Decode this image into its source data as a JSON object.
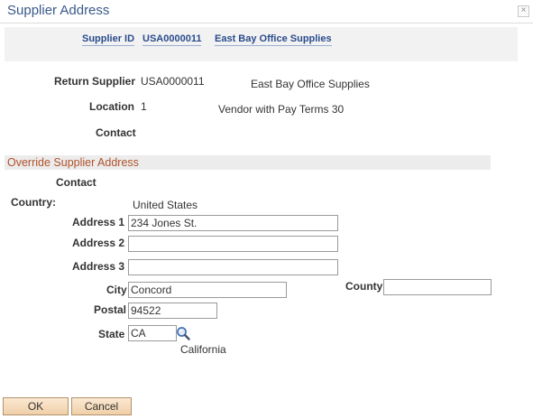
{
  "window": {
    "title": "Supplier Address",
    "close_glyph": "×"
  },
  "key_band": {
    "supplier_id_label": "Supplier ID",
    "supplier_id_value": "USA0000011",
    "supplier_name": "East Bay Office Supplies"
  },
  "header": {
    "return_supplier_label": "Return Supplier",
    "return_supplier_value": "USA0000011",
    "return_supplier_name": "East Bay Office Supplies",
    "location_label": "Location",
    "location_value": "1",
    "location_desc": "Vendor with Pay Terms 30",
    "contact_label": "Contact"
  },
  "override": {
    "section_title": "Override Supplier Address",
    "contact_label": "Contact",
    "country_label": "Country:",
    "country_value": "United States",
    "address1_label": "Address 1",
    "address1_value": "234 Jones St.",
    "address2_label": "Address 2",
    "address2_value": "",
    "address3_label": "Address 3",
    "address3_value": "",
    "city_label": "City",
    "city_value": "Concord",
    "county_label": "County",
    "county_value": "",
    "postal_label": "Postal",
    "postal_value": "94522",
    "state_label": "State",
    "state_value": "CA",
    "state_lookup_icon": "magnifier-lookup-icon",
    "state_desc": "California"
  },
  "footer": {
    "ok_label": "OK",
    "cancel_label": "Cancel"
  },
  "colors": {
    "title": "#3a5a8a",
    "link": "#2a4c8c",
    "section_title": "#b0522b",
    "button_fill": "#f0cfa8"
  }
}
